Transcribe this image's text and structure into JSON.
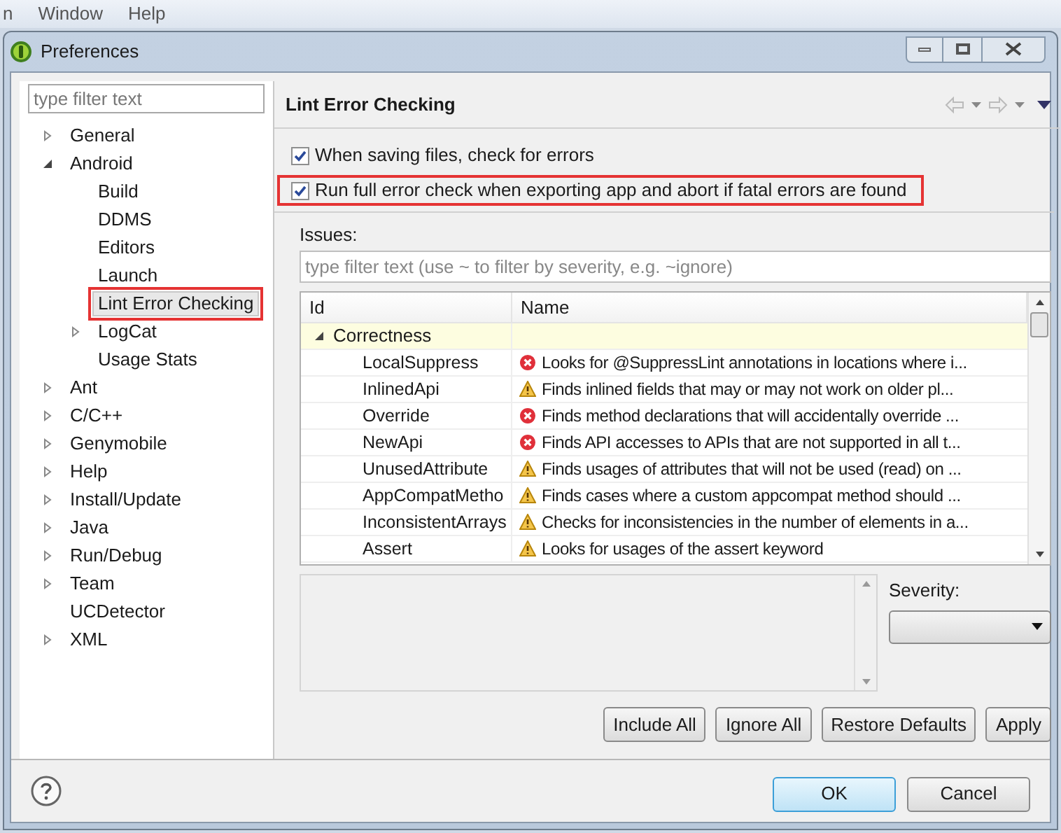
{
  "menu_bar": [
    "n",
    "Window",
    "Help"
  ],
  "window": {
    "title": "Preferences"
  },
  "sidebar": {
    "filter": {
      "placeholder": "type filter text"
    },
    "items": [
      {
        "label": "General",
        "expanded": false,
        "selected": false,
        "highlighted": false
      },
      {
        "label": "Android",
        "expanded": true,
        "selected": false,
        "highlighted": false,
        "children": [
          {
            "label": "Build",
            "selected": false,
            "highlighted": false
          },
          {
            "label": "DDMS",
            "selected": false,
            "highlighted": false
          },
          {
            "label": "Editors",
            "selected": false,
            "highlighted": false
          },
          {
            "label": "Launch",
            "selected": false,
            "highlighted": false
          },
          {
            "label": "Lint Error Checking",
            "selected": true,
            "highlighted": true
          },
          {
            "label": "LogCat",
            "expanded": false,
            "selected": false,
            "highlighted": false
          },
          {
            "label": "Usage Stats",
            "selected": false,
            "highlighted": false
          }
        ]
      },
      {
        "label": "Ant",
        "expanded": false,
        "selected": false,
        "highlighted": false
      },
      {
        "label": "C/C++",
        "expanded": false,
        "selected": false,
        "highlighted": false
      },
      {
        "label": "Genymobile",
        "expanded": false,
        "selected": false,
        "highlighted": false
      },
      {
        "label": "Help",
        "expanded": false,
        "selected": false,
        "highlighted": false
      },
      {
        "label": "Install/Update",
        "expanded": false,
        "selected": false,
        "highlighted": false
      },
      {
        "label": "Java",
        "expanded": false,
        "selected": false,
        "highlighted": false
      },
      {
        "label": "Run/Debug",
        "expanded": false,
        "selected": false,
        "highlighted": false
      },
      {
        "label": "Team",
        "expanded": false,
        "selected": false,
        "highlighted": false
      },
      {
        "label": "UCDetector",
        "selected": false,
        "highlighted": false
      },
      {
        "label": "XML",
        "expanded": false,
        "selected": false,
        "highlighted": false
      }
    ]
  },
  "page": {
    "title": "Lint Error Checking",
    "options": [
      {
        "label": "When saving files, check for errors",
        "checked": true,
        "highlighted": false
      },
      {
        "label": "Run full error check when exporting app and abort if fatal errors are found",
        "checked": true,
        "highlighted": true
      }
    ],
    "issues_label": "Issues:",
    "issues_filter": {
      "placeholder": "type filter text (use ~ to filter by severity, e.g. ~ignore)"
    },
    "table": {
      "columns": [
        "Id",
        "Name"
      ],
      "groups": [
        {
          "label": "Correctness",
          "expanded": true,
          "rows": [
            {
              "id": "LocalSuppress",
              "kind": "error",
              "name": "Looks for @SuppressLint annotations in locations where i..."
            },
            {
              "id": "InlinedApi",
              "kind": "warning",
              "name": "Finds inlined fields that may or may not work on older pl..."
            },
            {
              "id": "Override",
              "kind": "error",
              "name": "Finds method declarations that will accidentally override ..."
            },
            {
              "id": "NewApi",
              "kind": "error",
              "name": "Finds API accesses to APIs that are not supported in all t..."
            },
            {
              "id": "UnusedAttribute",
              "kind": "warning",
              "name": "Finds usages of attributes that will not be used (read) on ..."
            },
            {
              "id": "AppCompatMetho",
              "kind": "warning",
              "name": "Finds cases where a custom appcompat method should ..."
            },
            {
              "id": "InconsistentArrays",
              "kind": "warning",
              "name": "Checks for inconsistencies in the number of elements in a..."
            },
            {
              "id": "Assert",
              "kind": "warning",
              "name": "Looks for usages of the assert keyword"
            }
          ]
        }
      ]
    },
    "severity_label": "Severity:",
    "buttons": [
      "Include All",
      "Ignore All",
      "Restore Defaults",
      "Apply"
    ]
  },
  "dialog_buttons": [
    "OK",
    "Cancel"
  ]
}
